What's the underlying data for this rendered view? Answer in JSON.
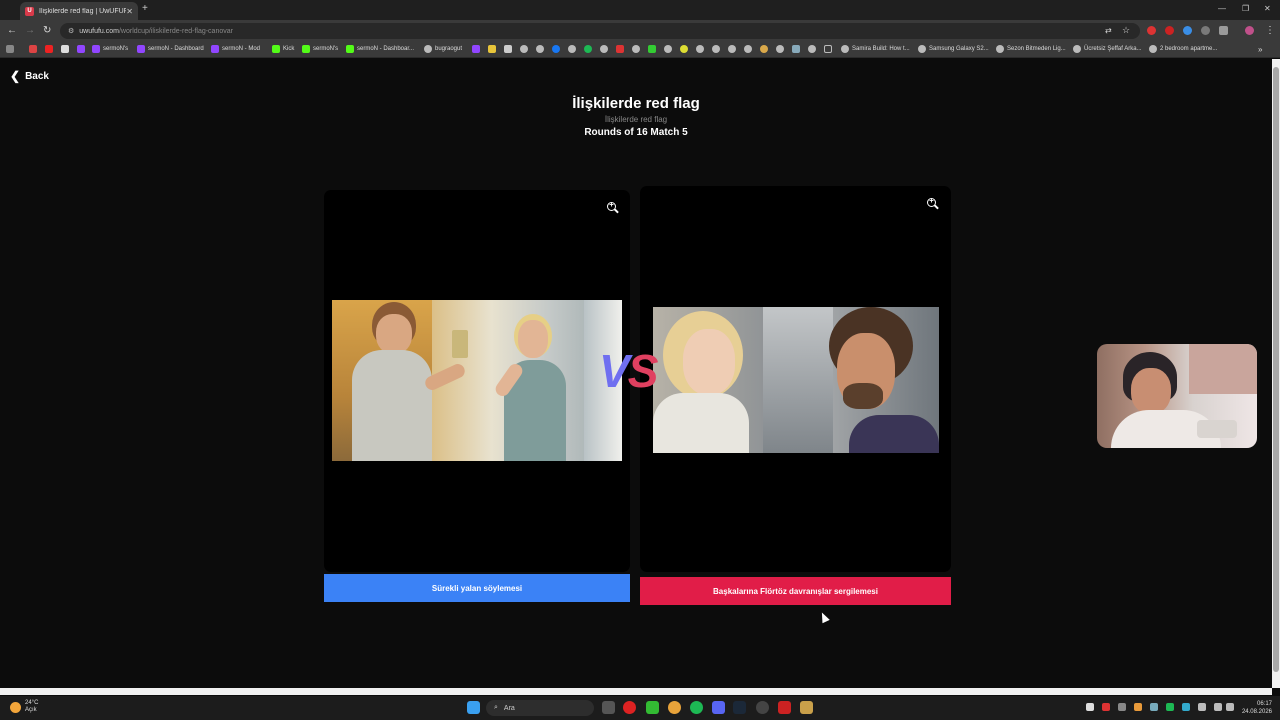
{
  "browser": {
    "tab_title": "İlişkilerde red flag | UwUFUFU",
    "tab_favicon_letter": "U",
    "url_host": "uwufufu.com",
    "url_path": "/worldcup/iliskilerde-red-flag-canovar",
    "bookmarks": [
      "sermoN's",
      "sermoN - Dashboard",
      "sermoN - Mod",
      "Kick",
      "sermoN's",
      "sermoN - Dashboar...",
      "bugraogut",
      "Samira Build: How t...",
      "Samsung Galaxy S2...",
      "Sezon Bitmeden Lig...",
      "Ücretsiz Şeffaf Arka...",
      "2 bedroom apartme..."
    ]
  },
  "page": {
    "back_label": "Back",
    "title": "İlişkilerde red flag",
    "subtitle": "İlişkilerde red flag",
    "round_info": "Rounds of 16 Match 5",
    "vs_v": "V",
    "vs_s": "S",
    "left_choice": "Sürekli yalan söylemesi",
    "right_choice": "Başkalarına Flörtöz davranışlar sergilemesi",
    "left_color": "#3b82f6",
    "right_color": "#e11d48"
  },
  "taskbar": {
    "temperature": "24°C",
    "weather_text": "Açık",
    "search_placeholder": "Ara",
    "time": "06:17",
    "date": "24.08.2026"
  }
}
